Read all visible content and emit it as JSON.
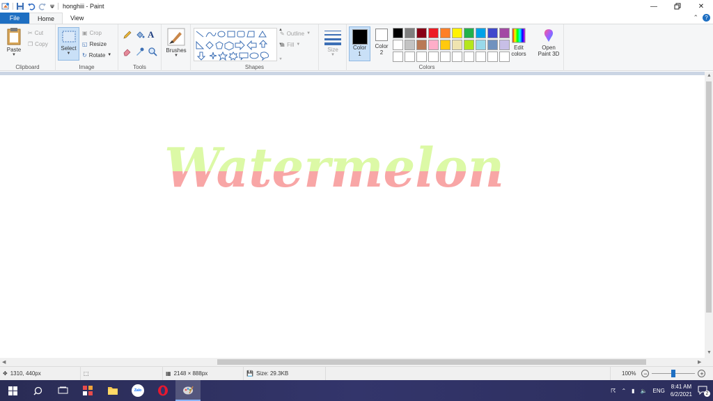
{
  "window": {
    "title": "honghiii - Paint"
  },
  "tabs": {
    "file": "File",
    "home": "Home",
    "view": "View"
  },
  "ribbon": {
    "clipboard": {
      "label": "Clipboard",
      "paste": "Paste",
      "cut": "Cut",
      "copy": "Copy"
    },
    "image": {
      "label": "Image",
      "select": "Select",
      "crop": "Crop",
      "resize": "Resize",
      "rotate": "Rotate"
    },
    "tools": {
      "label": "Tools"
    },
    "brushes": {
      "label": "Brushes"
    },
    "shapes": {
      "label": "Shapes",
      "outline": "Outline",
      "fill": "Fill"
    },
    "size": {
      "label": "Size"
    },
    "colors": {
      "label": "Colors",
      "color1": "Color",
      "color1_num": "1",
      "color2": "Color",
      "color2_num": "2",
      "edit_colors_1": "Edit",
      "edit_colors_2": "colors",
      "paint3d_1": "Open",
      "paint3d_2": "Paint 3D",
      "palette_row1": [
        "#000000",
        "#7f7f7f",
        "#880015",
        "#ed1c24",
        "#ff7f27",
        "#fff200",
        "#22b14c",
        "#00a2e8",
        "#3f48cc",
        "#a349a4"
      ],
      "palette_row2": [
        "#ffffff",
        "#c3c3c3",
        "#b97a57",
        "#ffaec9",
        "#ffc90e",
        "#efe4b0",
        "#b5e61d",
        "#99d9ea",
        "#7092be",
        "#c8bfe7"
      ]
    }
  },
  "canvas": {
    "text": "Watermelon",
    "top_color": "#dcf9a6",
    "bottom_color": "#f8a6a6"
  },
  "status": {
    "cursor_pos": "1310, 440px",
    "image_size": "2148 × 888px",
    "file_size": "Size: 29.3KB",
    "zoom": "100%"
  },
  "taskbar": {
    "time": "8:41 AM",
    "date": "6/2/2021",
    "lang": "ENG",
    "notif_count": "2",
    "zalo": "Zalo"
  }
}
